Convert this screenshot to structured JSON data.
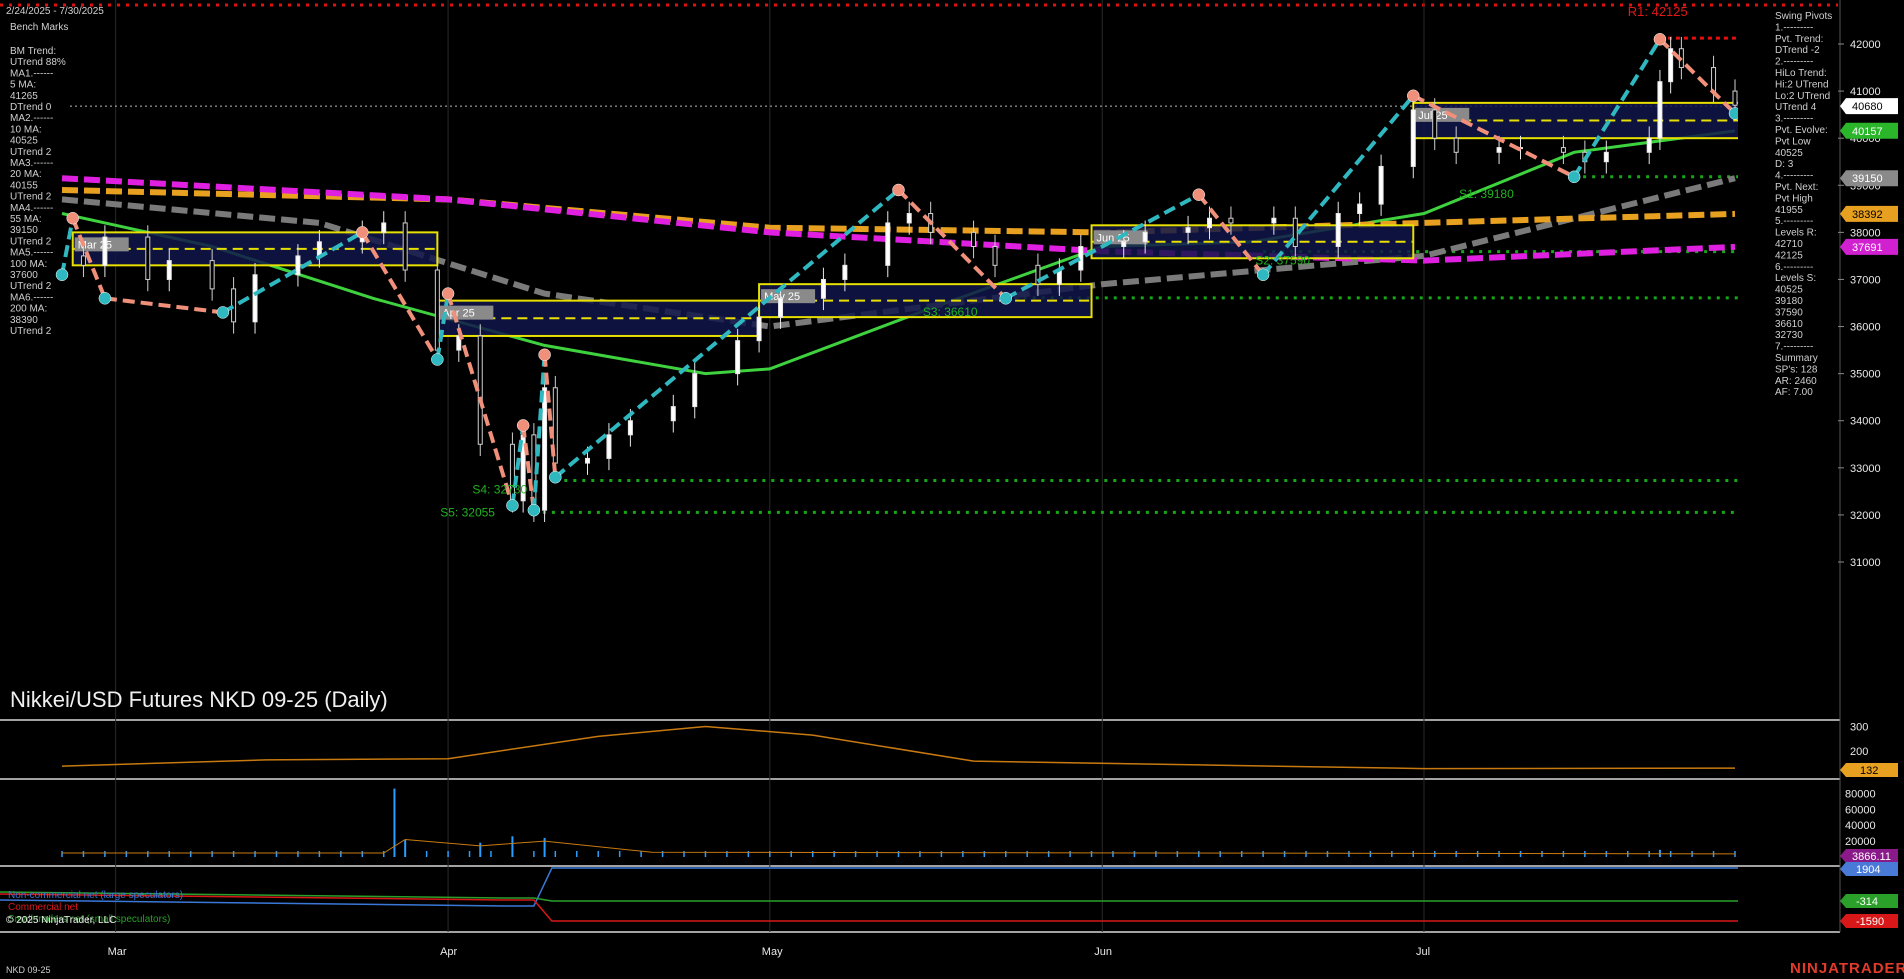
{
  "header": {
    "date_range": "2/24/2025 - 7/30/2025",
    "benchmarks_title": "Bench Marks",
    "benchmarks_lines": [
      "BM Trend:",
      "UTrend 88%",
      "MA1.------",
      "5 MA:",
      "41265",
      "DTrend 0",
      "MA2.------",
      "10 MA:",
      "40525",
      "UTrend 2",
      "MA3.------",
      "20 MA:",
      "40155",
      "UTrend 2",
      "MA4.------",
      "55 MA:",
      "39150",
      "UTrend 2",
      "MA5.------",
      "100 MA:",
      "37600",
      "UTrend 2",
      "MA6.------",
      "200 MA:",
      "38390",
      "UTrend 2"
    ]
  },
  "right_info": {
    "lines": [
      "Swing Pivots",
      "1.---------",
      "Pvt. Trend:",
      "DTrend -2",
      "2.---------",
      "HiLo Trend:",
      "Hi:2 UTrend",
      "Lo:2 UTrend",
      "UTrend 4",
      "3.---------",
      "Pvt. Evolve:",
      "Pvt Low",
      "40525",
      "D: 3",
      "4.---------",
      "Pvt. Next:",
      "Pvt High",
      "41955",
      "5.---------",
      "Levels R:",
      "42710",
      "42125",
      "6.---------",
      "Levels S:",
      "40525",
      "39180",
      "37590",
      "36610",
      "32730",
      "7.---------",
      "Summary",
      "SP's: 128",
      "AR: 2460",
      "AF: 7.00"
    ]
  },
  "title": "Nikkei/USD Futures NKD 09-25 (Daily)",
  "footer": {
    "symbol": "NKD 09-25",
    "copyright": "© 2025 NinjaTrader, LLC",
    "brand": "NINJATRADER"
  },
  "colors": {
    "background": "#000000",
    "ma_green": "#3fd23f",
    "ma_gray": "#7a7a7a",
    "ma_orange": "#e8a020",
    "ma_magenta": "#e020e0",
    "swing_down": "#f0907a",
    "swing_up": "#30b8c0",
    "support_green": "#17a817",
    "resistance_red": "#e01010",
    "box_yellow": "#e8e000",
    "box_fill": "#10154a",
    "atr_orange": "#c87a10",
    "volume_blue": "#2a9fff",
    "cot_blue": "#3a78d8",
    "cot_green": "#2aa02a",
    "cot_red": "#d81818"
  },
  "chart_data": [
    {
      "type": "candlestick",
      "title": "Nikkei/USD Futures NKD 09-25 (Daily)",
      "x_tick_labels": [
        "Mar",
        "Apr",
        "May",
        "Jun",
        "Jul"
      ],
      "y_tick_labels": [
        "42000",
        "41000",
        "40000",
        "39000",
        "38000",
        "37000",
        "36000",
        "35000",
        "34000",
        "33000",
        "32000",
        "31000"
      ],
      "ylim": [
        30200,
        43000
      ],
      "close_series": [
        {
          "date": "2025-02-24",
          "close": 37500
        },
        {
          "date": "2025-02-26",
          "close": 37300
        },
        {
          "date": "2025-02-28",
          "close": 37900
        },
        {
          "date": "2025-03-04",
          "close": 37000
        },
        {
          "date": "2025-03-06",
          "close": 37400
        },
        {
          "date": "2025-03-10",
          "close": 36800
        },
        {
          "date": "2025-03-12",
          "close": 36100
        },
        {
          "date": "2025-03-14",
          "close": 37100
        },
        {
          "date": "2025-03-18",
          "close": 37500
        },
        {
          "date": "2025-03-20",
          "close": 37800
        },
        {
          "date": "2025-03-24",
          "close": 38000
        },
        {
          "date": "2025-03-26",
          "close": 38200
        },
        {
          "date": "2025-03-28",
          "close": 37200
        },
        {
          "date": "2025-03-31",
          "close": 35500
        },
        {
          "date": "2025-04-02",
          "close": 35800
        },
        {
          "date": "2025-04-04",
          "close": 33500
        },
        {
          "date": "2025-04-07",
          "close": 32300
        },
        {
          "date": "2025-04-08",
          "close": 33700
        },
        {
          "date": "2025-04-09",
          "close": 32100
        },
        {
          "date": "2025-04-10",
          "close": 34700
        },
        {
          "date": "2025-04-11",
          "close": 33100
        },
        {
          "date": "2025-04-14",
          "close": 33200
        },
        {
          "date": "2025-04-16",
          "close": 33700
        },
        {
          "date": "2025-04-18",
          "close": 34000
        },
        {
          "date": "2025-04-22",
          "close": 34300
        },
        {
          "date": "2025-04-24",
          "close": 35000
        },
        {
          "date": "2025-04-28",
          "close": 35700
        },
        {
          "date": "2025-04-30",
          "close": 36200
        },
        {
          "date": "2025-05-02",
          "close": 36600
        },
        {
          "date": "2025-05-06",
          "close": 37000
        },
        {
          "date": "2025-05-08",
          "close": 37300
        },
        {
          "date": "2025-05-12",
          "close": 38200
        },
        {
          "date": "2025-05-14",
          "close": 38400
        },
        {
          "date": "2025-05-16",
          "close": 38000
        },
        {
          "date": "2025-05-20",
          "close": 37700
        },
        {
          "date": "2025-05-22",
          "close": 37300
        },
        {
          "date": "2025-05-26",
          "close": 36900
        },
        {
          "date": "2025-05-28",
          "close": 37200
        },
        {
          "date": "2025-05-30",
          "close": 37700
        },
        {
          "date": "2025-06-03",
          "close": 37800
        },
        {
          "date": "2025-06-05",
          "close": 38000
        },
        {
          "date": "2025-06-09",
          "close": 38100
        },
        {
          "date": "2025-06-11",
          "close": 38300
        },
        {
          "date": "2025-06-13",
          "close": 38200
        },
        {
          "date": "2025-06-17",
          "close": 38300
        },
        {
          "date": "2025-06-19",
          "close": 37700
        },
        {
          "date": "2025-06-23",
          "close": 38400
        },
        {
          "date": "2025-06-25",
          "close": 38600
        },
        {
          "date": "2025-06-27",
          "close": 39400
        },
        {
          "date": "2025-06-30",
          "close": 40600
        },
        {
          "date": "2025-07-02",
          "close": 40000
        },
        {
          "date": "2025-07-04",
          "close": 39700
        },
        {
          "date": "2025-07-08",
          "close": 39800
        },
        {
          "date": "2025-07-10",
          "close": 39800
        },
        {
          "date": "2025-07-14",
          "close": 39700
        },
        {
          "date": "2025-07-16",
          "close": 39500
        },
        {
          "date": "2025-07-18",
          "close": 39700
        },
        {
          "date": "2025-07-22",
          "close": 40000
        },
        {
          "date": "2025-07-23",
          "close": 41200
        },
        {
          "date": "2025-07-24",
          "close": 41900
        },
        {
          "date": "2025-07-25",
          "close": 41500
        },
        {
          "date": "2025-07-28",
          "close": 41000
        },
        {
          "date": "2025-07-30",
          "close": 40700
        }
      ],
      "swing_path": [
        {
          "date": "2025-02-24",
          "value": 37100
        },
        {
          "date": "2025-02-25",
          "value": 38300
        },
        {
          "date": "2025-02-28",
          "value": 36600
        },
        {
          "date": "2025-03-11",
          "value": 36300
        },
        {
          "date": "2025-03-24",
          "value": 38000
        },
        {
          "date": "2025-03-31",
          "value": 35300
        },
        {
          "date": "2025-04-01",
          "value": 36700
        },
        {
          "date": "2025-04-07",
          "value": 32200
        },
        {
          "date": "2025-04-08",
          "value": 33900
        },
        {
          "date": "2025-04-09",
          "value": 32100
        },
        {
          "date": "2025-04-10",
          "value": 35400
        },
        {
          "date": "2025-04-11",
          "value": 32800
        },
        {
          "date": "2025-05-13",
          "value": 38900
        },
        {
          "date": "2025-05-23",
          "value": 36600
        },
        {
          "date": "2025-06-10",
          "value": 38800
        },
        {
          "date": "2025-06-16",
          "value": 37100
        },
        {
          "date": "2025-06-30",
          "value": 40900
        },
        {
          "date": "2025-07-15",
          "value": 39180
        },
        {
          "date": "2025-07-23",
          "value": 42100
        },
        {
          "date": "2025-07-30",
          "value": 40525
        }
      ],
      "moving_averages": [
        {
          "name": "5 MA",
          "color": "#3fd23f",
          "points": [
            {
              "date": "2025-02-24",
              "value": 38400
            },
            {
              "date": "2025-03-10",
              "value": 37700
            },
            {
              "date": "2025-03-25",
              "value": 36600
            },
            {
              "date": "2025-04-10",
              "value": 35600
            },
            {
              "date": "2025-04-25",
              "value": 35000
            },
            {
              "date": "2025-05-01",
              "value": 35100
            },
            {
              "date": "2025-05-15",
              "value": 36300
            },
            {
              "date": "2025-06-01",
              "value": 37700
            },
            {
              "date": "2025-06-15",
              "value": 37800
            },
            {
              "date": "2025-07-01",
              "value": 38400
            },
            {
              "date": "2025-07-15",
              "value": 39700
            },
            {
              "date": "2025-07-30",
              "value": 40155
            }
          ]
        },
        {
          "name": "55 MA",
          "color": "#7a7a7a",
          "points": [
            {
              "date": "2025-02-24",
              "value": 38700
            },
            {
              "date": "2025-03-20",
              "value": 38200
            },
            {
              "date": "2025-04-10",
              "value": 36700
            },
            {
              "date": "2025-05-01",
              "value": 36000
            },
            {
              "date": "2025-06-01",
              "value": 36900
            },
            {
              "date": "2025-07-01",
              "value": 37500
            },
            {
              "date": "2025-07-30",
              "value": 39150
            }
          ]
        },
        {
          "name": "200 MA",
          "color": "#e8a020",
          "points": [
            {
              "date": "2025-02-24",
              "value": 38900
            },
            {
              "date": "2025-04-01",
              "value": 38700
            },
            {
              "date": "2025-05-01",
              "value": 38100
            },
            {
              "date": "2025-06-01",
              "value": 38000
            },
            {
              "date": "2025-07-01",
              "value": 38200
            },
            {
              "date": "2025-07-30",
              "value": 38392
            }
          ]
        },
        {
          "name": "100 MA",
          "color": "#e020e0",
          "points": [
            {
              "date": "2025-02-24",
              "value": 39150
            },
            {
              "date": "2025-04-01",
              "value": 38700
            },
            {
              "date": "2025-05-01",
              "value": 38000
            },
            {
              "date": "2025-06-01",
              "value": 37600
            },
            {
              "date": "2025-07-01",
              "value": 37400
            },
            {
              "date": "2025-07-30",
              "value": 37691
            }
          ]
        }
      ],
      "support_levels": [
        {
          "label": "S1: 39180",
          "value": 39180
        },
        {
          "label": "S2: 37590",
          "value": 37590
        },
        {
          "label": "S3: 36610",
          "value": 36610
        },
        {
          "label": "S4: 32730",
          "value": 32730
        },
        {
          "label": "S5: 32055",
          "value": 32055
        }
      ],
      "resistance_levels": [
        {
          "label": "R1: 42125",
          "value": 42125
        }
      ],
      "range_boxes": [
        {
          "label": "Mar 25",
          "start": "2025-02-25",
          "end": "2025-03-31",
          "low": 37300,
          "high": 38000
        },
        {
          "label": "Apr 25",
          "start": "2025-03-31",
          "end": "2025-04-30",
          "low": 35800,
          "high": 36550
        },
        {
          "label": "May 25",
          "start": "2025-04-30",
          "end": "2025-05-31",
          "low": 36200,
          "high": 36900
        },
        {
          "label": "Jun 25",
          "start": "2025-05-31",
          "end": "2025-06-30",
          "low": 37450,
          "high": 38150
        },
        {
          "label": "Jul 25",
          "start": "2025-06-30",
          "end": "2025-07-31",
          "low": 40000,
          "high": 40750
        }
      ],
      "right_axis_tags": [
        {
          "value": "40680",
          "bg": "#ffffff",
          "fg": "#000000"
        },
        {
          "value": "40157",
          "bg": "#2bb52b",
          "fg": "#ffffff"
        },
        {
          "value": "39150",
          "bg": "#8a8a8a",
          "fg": "#ffffff"
        },
        {
          "value": "38392",
          "bg": "#e8a020",
          "fg": "#000000"
        },
        {
          "value": "37691",
          "bg": "#d020d0",
          "fg": "#ffffff"
        }
      ]
    },
    {
      "type": "line",
      "name": "ATR",
      "y_tick_labels": [
        "300",
        "200"
      ],
      "last_tag": "132",
      "points": [
        {
          "date": "2025-02-24",
          "value": 140
        },
        {
          "date": "2025-03-15",
          "value": 165
        },
        {
          "date": "2025-04-01",
          "value": 170
        },
        {
          "date": "2025-04-15",
          "value": 260
        },
        {
          "date": "2025-04-25",
          "value": 300
        },
        {
          "date": "2025-05-05",
          "value": 265
        },
        {
          "date": "2025-05-20",
          "value": 160
        },
        {
          "date": "2025-06-10",
          "value": 145
        },
        {
          "date": "2025-07-01",
          "value": 130
        },
        {
          "date": "2025-07-30",
          "value": 132
        }
      ]
    },
    {
      "type": "bar",
      "name": "Volume",
      "y_tick_labels": [
        "80000",
        "60000",
        "40000",
        "20000"
      ],
      "last_tag": "3866.11",
      "values": [
        {
          "date": "2025-03-27",
          "value": 86000
        },
        {
          "date": "2025-03-28",
          "value": 22000
        },
        {
          "date": "2025-04-04",
          "value": 18000
        },
        {
          "date": "2025-04-07",
          "value": 26000
        },
        {
          "date": "2025-04-10",
          "value": 24000
        },
        {
          "date": "2025-07-23",
          "value": 9000
        }
      ]
    },
    {
      "type": "line",
      "name": "COT",
      "series": [
        {
          "name": "Non-commercial net (large speculators)",
          "last_tag": "1904"
        },
        {
          "name": "Commercial net",
          "last_tag": "-1590"
        },
        {
          "name": "Small traders net (small speculators)",
          "last_tag": "-314"
        }
      ]
    }
  ]
}
